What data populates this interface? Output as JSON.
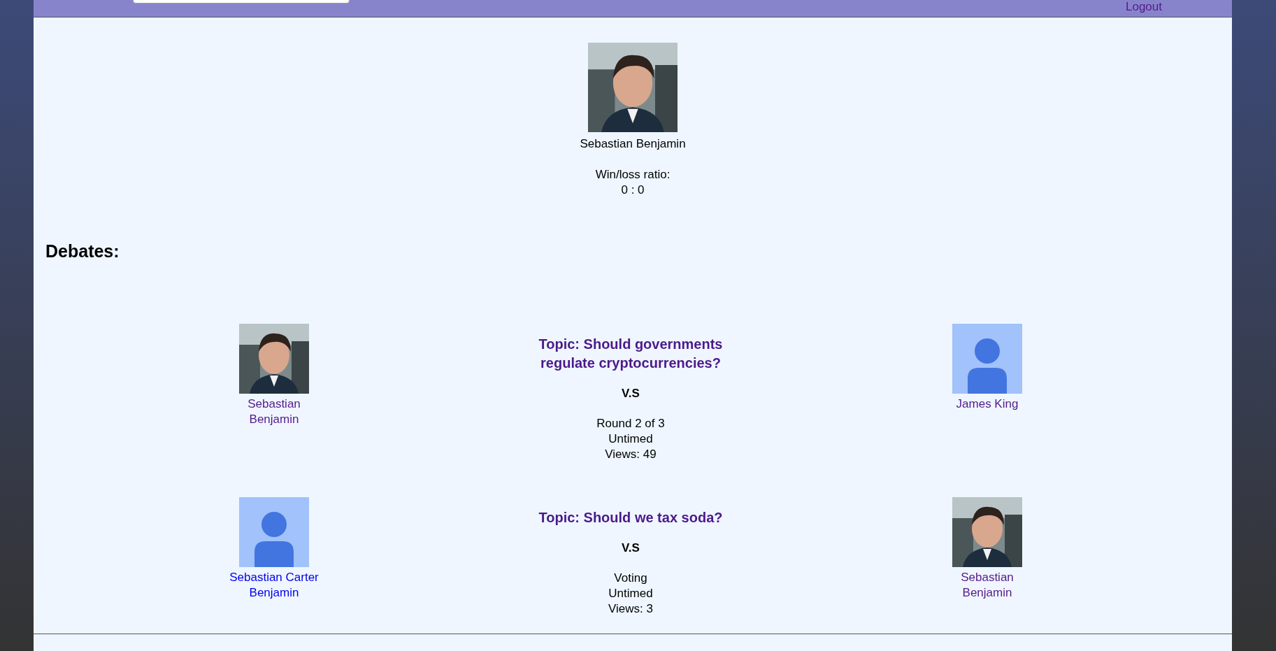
{
  "header": {
    "logout": "Logout"
  },
  "profile": {
    "name": "Sebastian Benjamin",
    "ratio_label": "Win/loss ratio:",
    "ratio": "0 : 0"
  },
  "debates_heading": "Debates:",
  "debates": [
    {
      "left": {
        "name": "Sebastian Benjamin",
        "visited": true
      },
      "topic": "Topic: Should governments regulate cryptocurrencies?",
      "vs": "V.S",
      "status": [
        "Round 2 of 3",
        "Untimed",
        "Views: 49"
      ],
      "right": {
        "name": "James King",
        "avatar": {
          "kind": "default"
        },
        "visited": true
      }
    },
    {
      "left": {
        "name": "Sebastian Carter Benjamin",
        "avatar": {
          "kind": "default"
        },
        "visited": false
      },
      "topic": "Topic: Should we tax soda?",
      "vs": "V.S",
      "status": [
        "Voting",
        "Untimed",
        "Views: 3"
      ],
      "right": {
        "name": "Sebastian Benjamin",
        "visited": true
      }
    }
  ]
}
